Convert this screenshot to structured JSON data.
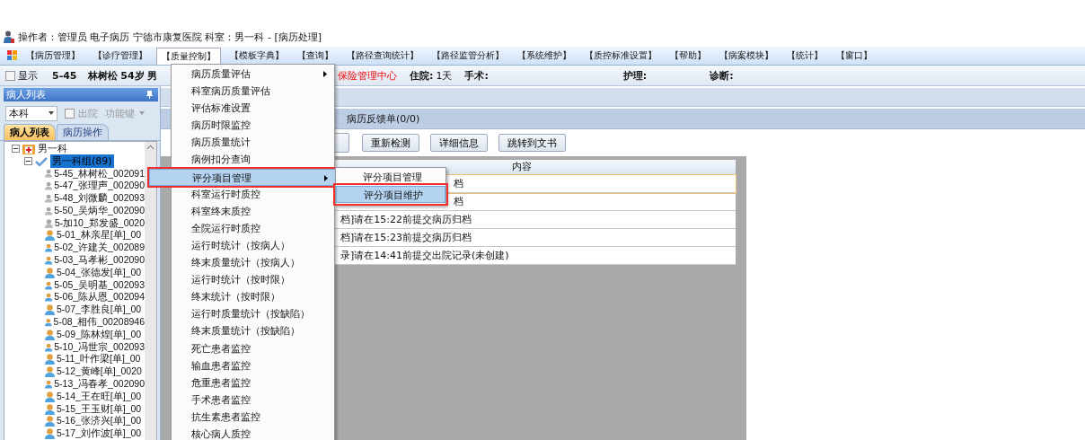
{
  "title": "操作者：管理员 电子病历  宁德市康复医院  科室：男一科 - [病历处理]",
  "menubar": [
    {
      "label": "【病历管理】",
      "selected": false
    },
    {
      "label": "【诊疗管理】",
      "selected": false
    },
    {
      "label": "【质量控制】",
      "selected": true
    },
    {
      "label": "【模板字典】",
      "selected": false
    },
    {
      "label": "【查询】",
      "selected": false
    },
    {
      "label": "【路径查询统计】",
      "selected": false
    },
    {
      "label": "【路径监管分析】",
      "selected": false
    },
    {
      "label": "【系统维护】",
      "selected": false
    },
    {
      "label": "【质控标准设置】",
      "selected": false
    },
    {
      "label": "【帮助】",
      "selected": false
    },
    {
      "label": "【病案模块】",
      "selected": false
    },
    {
      "label": "【统计】",
      "selected": false
    },
    {
      "label": "【窗口】",
      "selected": false
    }
  ],
  "patient_bar": {
    "show_checkbox": {
      "label": "显示",
      "checked": false
    },
    "bed": "5-45",
    "name": "林树松 54岁 男",
    "insurance": "保险管理中心",
    "stay_label": "住院:",
    "stay": "1天",
    "surgery_label": "手术:",
    "nursing_label": "护理:",
    "diagnosis_label": "诊断:"
  },
  "left_panel": {
    "title": "病人列表",
    "dept_select": "本科",
    "discharged": {
      "label": "出院",
      "checked": false
    },
    "function_key": "功能键",
    "tabs": [
      {
        "label": "病人列表",
        "selected": true
      },
      {
        "label": "病历操作",
        "selected": false
      }
    ],
    "tree": {
      "label": "男一科",
      "expanded": true,
      "children": [
        {
          "label": "男一科组(89)",
          "selected": true,
          "expanded": true,
          "children": [
            {
              "label": "5-45_林树松_002091",
              "kind": "inactive"
            },
            {
              "label": "5-47_张理声_002090",
              "kind": "inactive"
            },
            {
              "label": "5-48_刘微麟_002093",
              "kind": "inactive"
            },
            {
              "label": "5-50_吴炳华_002090",
              "kind": "inactive"
            },
            {
              "label": "5-加10_郑发盛_0020",
              "kind": "inactive"
            },
            {
              "label": "5-01_林亲星[单]_00",
              "kind": "active"
            },
            {
              "label": "5-02_许建关_002089",
              "kind": "active"
            },
            {
              "label": "5-03_马孝彬_002090",
              "kind": "active"
            },
            {
              "label": "5-04_张德发[单]_00",
              "kind": "active"
            },
            {
              "label": "5-05_吴明基_002093",
              "kind": "active"
            },
            {
              "label": "5-06_陈从恩_002094",
              "kind": "active"
            },
            {
              "label": "5-07_李胜良[单]_00",
              "kind": "active"
            },
            {
              "label": "5-08_相伟_00208946",
              "kind": "active"
            },
            {
              "label": "5-09_陈林煌[单]_00",
              "kind": "active"
            },
            {
              "label": "5-10_冯世宗_002093",
              "kind": "active"
            },
            {
              "label": "5-11_叶作梁[单]_00",
              "kind": "active"
            },
            {
              "label": "5-12_黄峰[单]_0020",
              "kind": "active"
            },
            {
              "label": "5-13_冯春孝_002090",
              "kind": "active"
            },
            {
              "label": "5-14_王在旺[单]_00",
              "kind": "active"
            },
            {
              "label": "5-15_王玉财[单]_00",
              "kind": "active"
            },
            {
              "label": "5-16_张济兴[单]_00",
              "kind": "active"
            },
            {
              "label": "5-17_刘作波[单]_00",
              "kind": "active"
            }
          ]
        }
      ]
    }
  },
  "feedback_tab": "病历反馈单(0/0)",
  "buttons": [
    "重新检测",
    "详细信息",
    "跳转到文书"
  ],
  "table": {
    "columns": [
      "内容"
    ],
    "rows": [
      "档",
      "档",
      "档]请在15:22前提交病历归档",
      "档]请在15:23前提交病历归档",
      "录]请在14:41前提交出院记录(未创建)"
    ]
  },
  "dropdown": {
    "items": [
      {
        "label": "病历质量评估",
        "submenu": true,
        "selected": false,
        "highlighted": false
      },
      {
        "label": "科室病历质量评估",
        "submenu": false,
        "selected": false,
        "highlighted": false
      },
      {
        "label": "评估标准设置",
        "submenu": false,
        "selected": false,
        "highlighted": false
      },
      {
        "label": "病历时限监控",
        "submenu": false,
        "selected": false,
        "highlighted": false
      },
      {
        "label": "病历质量统计",
        "submenu": false,
        "selected": false,
        "highlighted": false
      },
      {
        "label": "病例扣分查询",
        "submenu": false,
        "selected": false,
        "highlighted": false
      },
      {
        "label": "评分项目管理",
        "submenu": true,
        "selected": true,
        "highlighted": true
      },
      {
        "label": "科室运行时质控",
        "submenu": false,
        "selected": false,
        "highlighted": false
      },
      {
        "label": "科室终末质控",
        "submenu": false,
        "selected": false,
        "highlighted": false
      },
      {
        "label": "全院运行时质控",
        "submenu": false,
        "selected": false,
        "highlighted": false
      },
      {
        "label": "运行时统计（按病人）",
        "submenu": false,
        "selected": false,
        "highlighted": false
      },
      {
        "label": "终末质量统计（按病人）",
        "submenu": false,
        "selected": false,
        "highlighted": false
      },
      {
        "label": "运行时统计（按时限）",
        "submenu": false,
        "selected": false,
        "highlighted": false
      },
      {
        "label": "终末统计（按时限）",
        "submenu": false,
        "selected": false,
        "highlighted": false
      },
      {
        "label": "运行时质量统计（按缺陷）",
        "submenu": false,
        "selected": false,
        "highlighted": false
      },
      {
        "label": "终末质量统计（按缺陷）",
        "submenu": false,
        "selected": false,
        "highlighted": false
      },
      {
        "label": "死亡患者监控",
        "submenu": false,
        "selected": false,
        "highlighted": false
      },
      {
        "label": "输血患者监控",
        "submenu": false,
        "selected": false,
        "highlighted": false
      },
      {
        "label": "危重患者监控",
        "submenu": false,
        "selected": false,
        "highlighted": false
      },
      {
        "label": "手术患者监控",
        "submenu": false,
        "selected": false,
        "highlighted": false
      },
      {
        "label": "抗生素患者监控",
        "submenu": false,
        "selected": false,
        "highlighted": false
      },
      {
        "label": "核心病人质控",
        "submenu": false,
        "selected": false,
        "highlighted": false
      }
    ]
  },
  "submenu": {
    "items": [
      {
        "label": "评分项目管理",
        "selected": false,
        "highlighted": false
      },
      {
        "label": "评分项目维护",
        "selected": true,
        "highlighted": true
      }
    ]
  }
}
